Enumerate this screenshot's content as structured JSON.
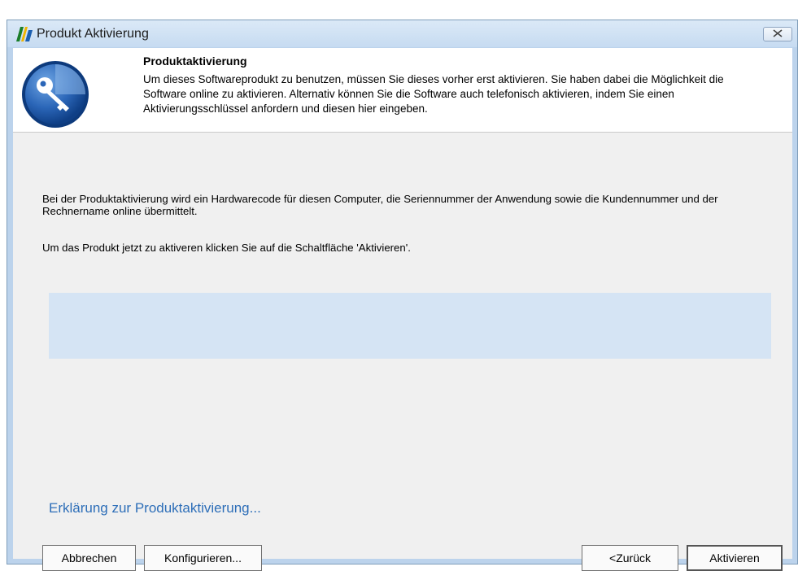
{
  "window": {
    "title": "Produkt Aktivierung"
  },
  "header": {
    "title": "Produktaktivierung",
    "description": "Um dieses Softwareprodukt zu benutzen, müssen Sie dieses vorher erst aktivieren. Sie haben dabei die Möglichkeit die Software online zu aktivieren. Alternativ können Sie die Software auch telefonisch aktivieren, indem Sie einen Aktivierungsschlüssel anfordern und diesen hier eingeben."
  },
  "body": {
    "paragraph1": "Bei der Produktaktivierung wird ein Hardwarecode für diesen Computer, die Seriennummer der Anwendung sowie die Kundennummer und der Rechnername online übermittelt.",
    "paragraph2": "Um das Produkt jetzt zu aktiveren klicken Sie auf die Schaltfläche 'Aktivieren'."
  },
  "link": {
    "label": "Erklärung zur Produktaktivierung..."
  },
  "buttons": {
    "cancel": "Abbrechen",
    "configure": "Konfigurieren...",
    "back": "<Zurück",
    "activate": "Aktivieren"
  },
  "icons": {
    "app": "app-logo-icon",
    "close": "close-icon",
    "key": "key-icon"
  },
  "colors": {
    "accent": "#2d6eb8",
    "panel": "#d5e4f4",
    "title_bar": "#c6dbf1"
  }
}
